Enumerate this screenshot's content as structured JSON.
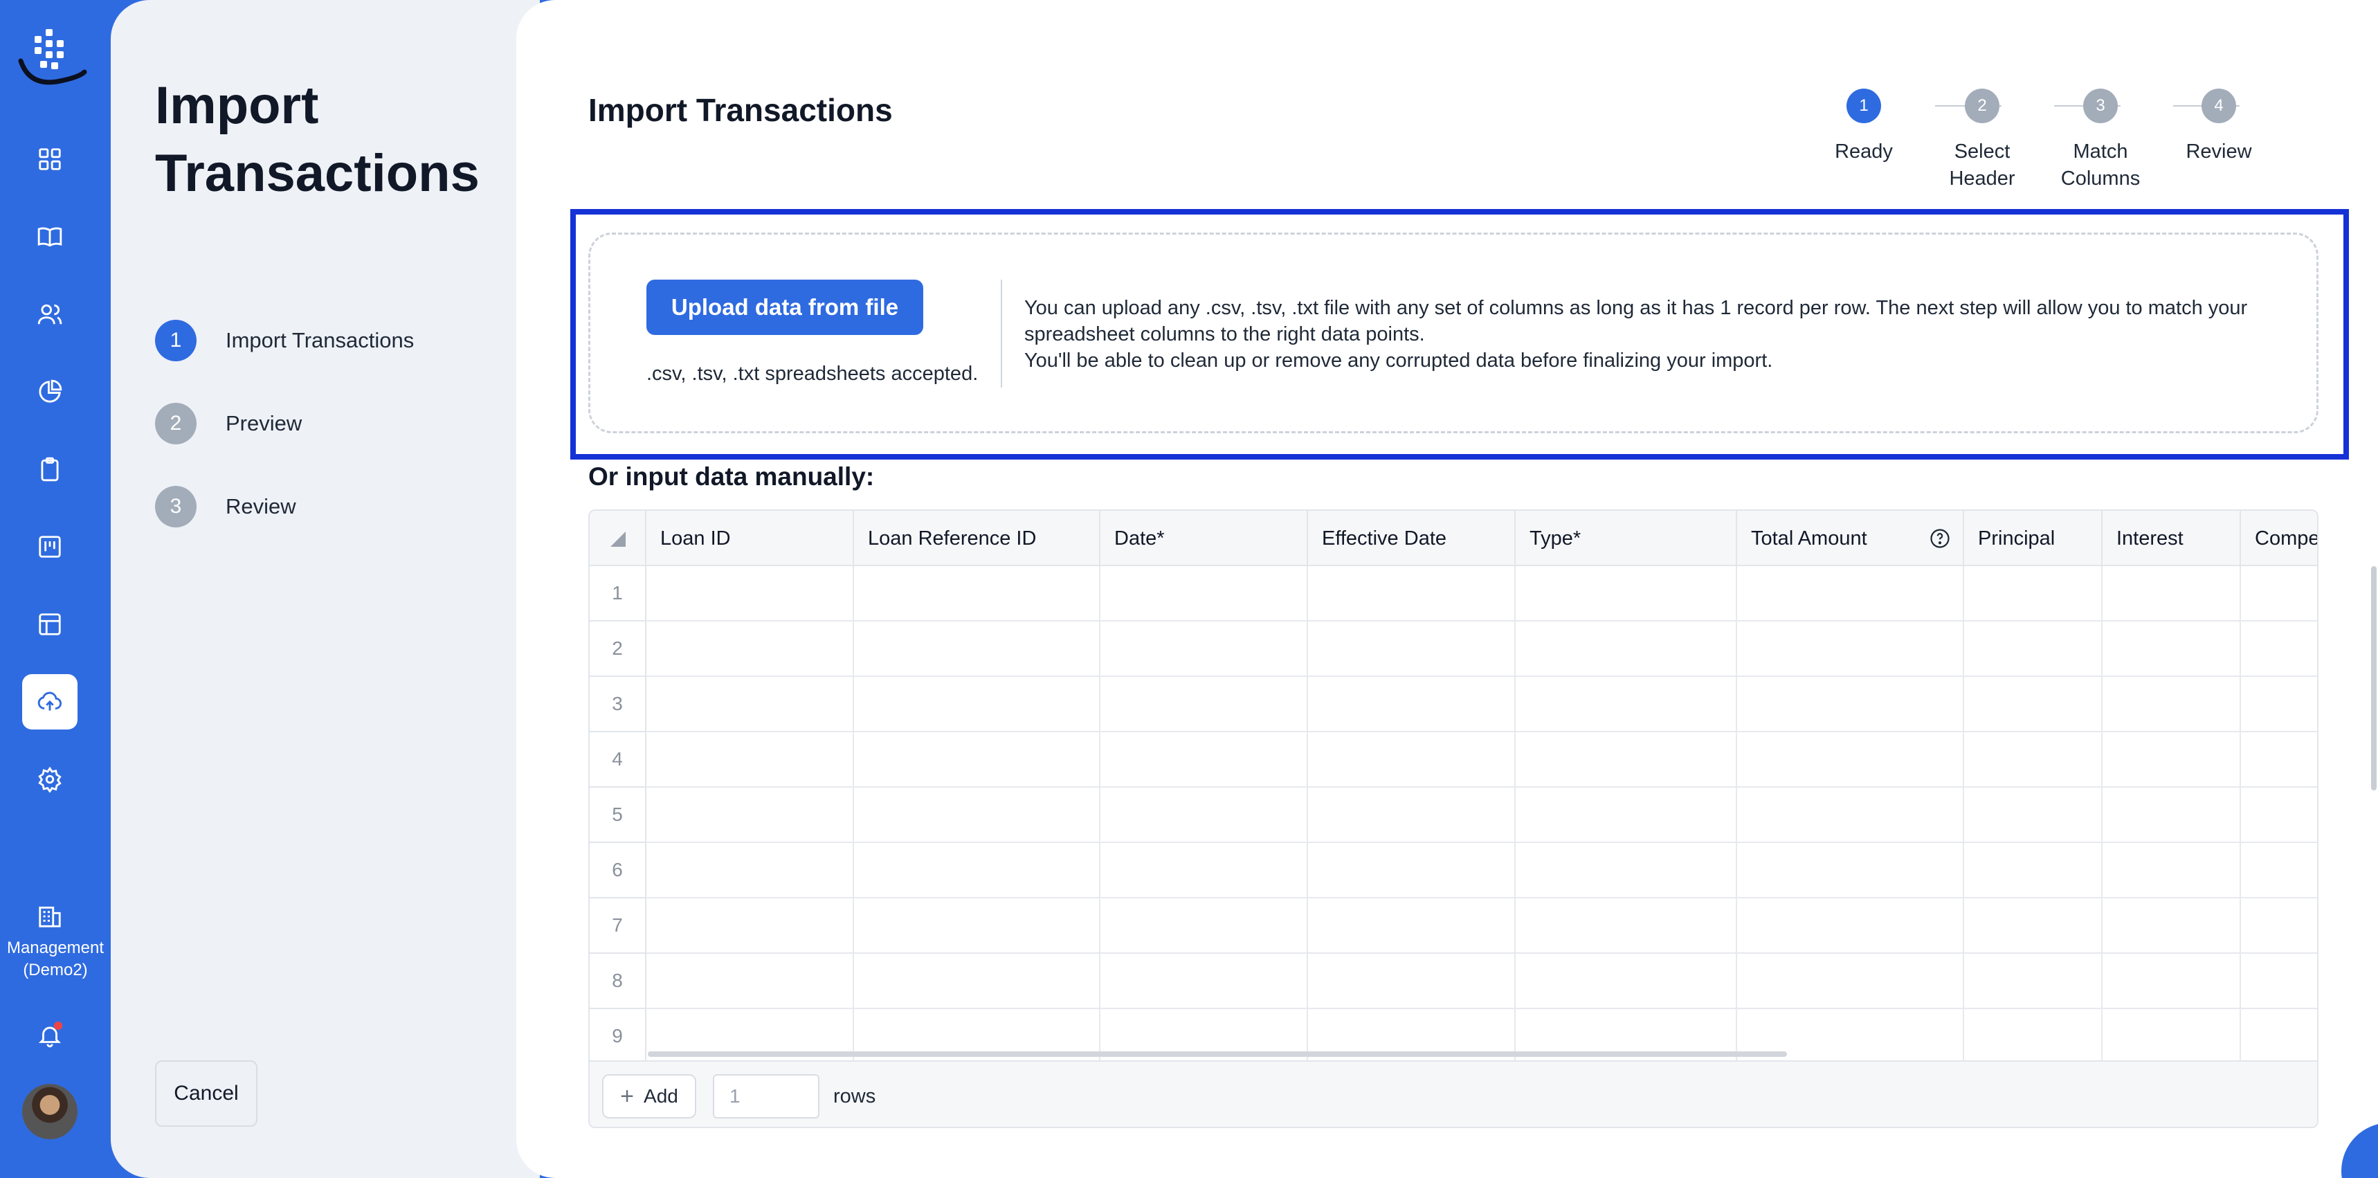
{
  "rail": {
    "icons": [
      "dashboard-icon",
      "book-icon",
      "users-icon",
      "pie-chart-icon",
      "clipboard-icon",
      "board-icon",
      "table-icon",
      "upload-cloud-icon",
      "gear-icon"
    ],
    "org_label": "Management (Demo2)"
  },
  "wizard": {
    "title": "Import Transactions",
    "steps": [
      {
        "num": "1",
        "label": "Import Transactions",
        "active": true
      },
      {
        "num": "2",
        "label": "Preview",
        "active": false
      },
      {
        "num": "3",
        "label": "Review",
        "active": false
      }
    ],
    "cancel_label": "Cancel"
  },
  "main": {
    "title": "Import Transactions",
    "stepper": [
      {
        "num": "1",
        "label": "Ready",
        "active": true
      },
      {
        "num": "2",
        "label": "Select Header",
        "active": false
      },
      {
        "num": "3",
        "label": "Match Columns",
        "active": false
      },
      {
        "num": "4",
        "label": "Review",
        "active": false
      }
    ],
    "upload": {
      "button_label": "Upload data from file",
      "accepted_text": ".csv, .tsv, .txt spreadsheets accepted.",
      "desc_line1": "You can upload any .csv, .tsv, .txt file with any set of columns as long as it has 1 record per row. The next step will allow you to match your spreadsheet columns to the right data points.",
      "desc_line2": "You'll be able to clean up or remove any corrupted data before finalizing your import."
    },
    "manual_label": "Or input data manually:",
    "grid": {
      "columns": [
        "Loan ID",
        "Loan Reference ID",
        "Date*",
        "Effective Date",
        "Type*",
        "Total Amount",
        "Principal",
        "Interest",
        "Compe"
      ],
      "row_numbers": [
        "1",
        "2",
        "3",
        "4",
        "5",
        "6",
        "7",
        "8",
        "9"
      ]
    },
    "footer": {
      "add_label": "Add",
      "rows_value": "1",
      "rows_label": "rows"
    }
  },
  "colors": {
    "brand": "#2f6be0",
    "highlight": "#1532d6"
  }
}
